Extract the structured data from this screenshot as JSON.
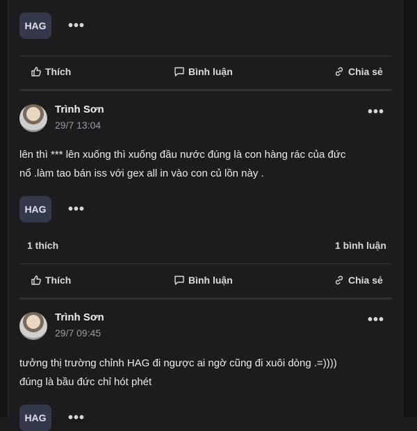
{
  "top_post": {
    "tag": "HAG",
    "more": "•••"
  },
  "actions": {
    "like": "Thích",
    "comment": "Bình luận",
    "share": "Chia sẻ"
  },
  "posts": [
    {
      "author": "Trình Sơn",
      "time": "29/7 13:04",
      "content_line1": "lên thì *** lên xuống thì xuống đầu nước đúng là con hàng rác của đức",
      "content_line2": "nổ .làm tao bán iss với gex all in vào con củ lồn này .",
      "tag": "HAG",
      "likes": "1 thích",
      "comments": "1 bình luận",
      "more": "•••"
    },
    {
      "author": "Trình Sơn",
      "time": "29/7 09:45",
      "content_line1": "tưởng thị trường chỉnh HAG đi ngược ai ngờ cũng đi xuôi dòng .=))))",
      "content_line2": "đúng là bầu đức chỉ hót phét",
      "tag": "HAG",
      "more": "•••"
    }
  ]
}
